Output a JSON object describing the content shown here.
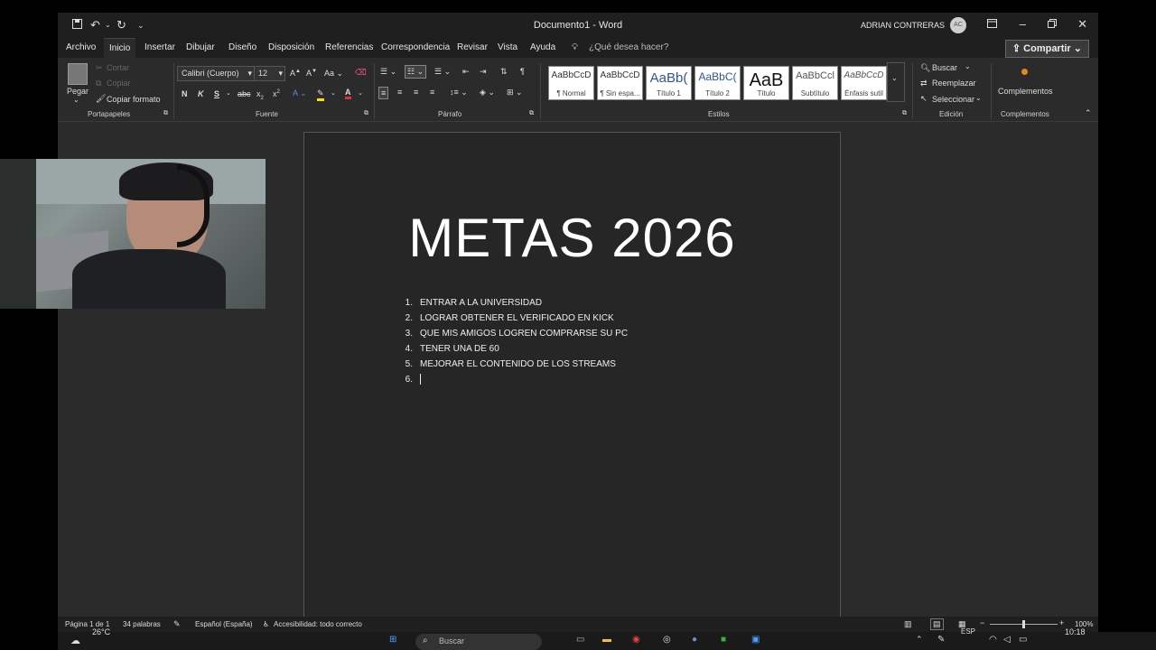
{
  "titlebar": {
    "title": "Documento1  -  Word",
    "user": "ADRIAN CONTRERAS",
    "user_initials": "AC"
  },
  "menu": {
    "tabs": [
      "Archivo",
      "Inicio",
      "Insertar",
      "Dibujar",
      "Diseño",
      "Disposición",
      "Referencias",
      "Correspondencia",
      "Revisar",
      "Vista",
      "Ayuda"
    ],
    "search_placeholder": "¿Qué desea hacer?",
    "share_label": "Compartir"
  },
  "ribbon": {
    "clipboard": {
      "paste": "Pegar",
      "cut": "Cortar",
      "copy": "Copiar",
      "format_painter": "Copiar formato",
      "label": "Portapapeles"
    },
    "font": {
      "name": "Calibri (Cuerpo)",
      "size": "12",
      "label": "Fuente",
      "bold": "N",
      "italic": "K",
      "underline": "S"
    },
    "paragraph": {
      "label": "Párrafo"
    },
    "styles": {
      "label": "Estilos",
      "items": [
        {
          "preview": "AaBbCcD",
          "name": "¶ Normal"
        },
        {
          "preview": "AaBbCcD",
          "name": "¶ Sin espa..."
        },
        {
          "preview": "AaBb(",
          "name": "Título 1"
        },
        {
          "preview": "AaBbC(",
          "name": "Título 2"
        },
        {
          "preview": "AaB",
          "name": "Título"
        },
        {
          "preview": "AaBbCcl",
          "name": "Subtítulo"
        },
        {
          "preview": "AaBbCcD",
          "name": "Énfasis sutil"
        }
      ]
    },
    "editing": {
      "label": "Edición",
      "find": "Buscar",
      "replace": "Reemplazar",
      "select": "Seleccionar"
    },
    "addins": {
      "label": "Complementos",
      "button": "Complementos"
    }
  },
  "document": {
    "title": "METAS 2026",
    "goals": [
      {
        "num": "1.",
        "text": "ENTRAR A LA UNIVERSIDAD"
      },
      {
        "num": "2.",
        "text": "LOGRAR OBTENER EL VERIFICADO EN KICK"
      },
      {
        "num": "3.",
        "text": "QUE MIS AMIGOS LOGREN COMPRARSE SU PC"
      },
      {
        "num": "4.",
        "text": "TENER UNA DE 60"
      },
      {
        "num": "5.",
        "text": "MEJORAR EL CONTENIDO DE LOS STREAMS"
      },
      {
        "num": "6.",
        "text": ""
      }
    ]
  },
  "status": {
    "page": "Página 1 de 1",
    "words": "34 palabras",
    "language": "Español (España)",
    "accessibility": "Accesibilidad: todo correcto",
    "zoom": "100%"
  },
  "taskbar": {
    "weather": "26°C",
    "search": "Buscar",
    "lang": "ESP",
    "time": "10:18"
  }
}
